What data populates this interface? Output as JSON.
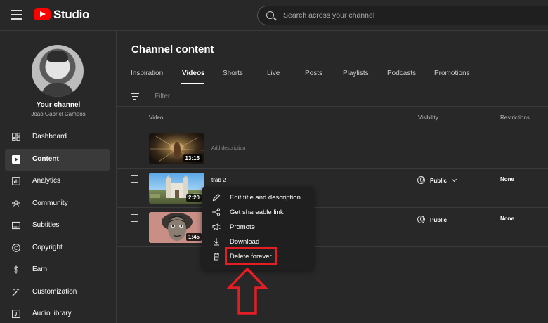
{
  "header": {
    "logo_text": "Studio",
    "search_placeholder": "Search across your channel"
  },
  "sidebar": {
    "channel_title": "Your channel",
    "channel_name": "João Gabriel Campos",
    "items": [
      {
        "label": "Dashboard",
        "icon": "dashboard-icon"
      },
      {
        "label": "Content",
        "icon": "content-icon",
        "active": true
      },
      {
        "label": "Analytics",
        "icon": "analytics-icon"
      },
      {
        "label": "Community",
        "icon": "community-icon"
      },
      {
        "label": "Subtitles",
        "icon": "subtitles-icon"
      },
      {
        "label": "Copyright",
        "icon": "copyright-icon"
      },
      {
        "label": "Earn",
        "icon": "earn-icon"
      },
      {
        "label": "Customization",
        "icon": "customization-icon"
      },
      {
        "label": "Audio library",
        "icon": "audio-library-icon"
      }
    ]
  },
  "main": {
    "title": "Channel content",
    "tabs": [
      "Inspiration",
      "Videos",
      "Shorts",
      "Live",
      "Posts",
      "Playlists",
      "Podcasts",
      "Promotions"
    ],
    "active_tab": "Videos",
    "filter_placeholder": "Filter",
    "columns": {
      "video": "Video",
      "visibility": "Visibility",
      "restrictions": "Restrictions"
    },
    "rows": [
      {
        "title": "",
        "description": "Add description",
        "duration": "13:15",
        "visibility": "",
        "restrictions": ""
      },
      {
        "title": "trab 2",
        "description": "",
        "duration": "2:20",
        "visibility": "Public",
        "restrictions": "None"
      },
      {
        "title": "",
        "description": "",
        "duration": "1:45",
        "visibility": "Public",
        "restrictions": "None"
      }
    ]
  },
  "context_menu": {
    "items": [
      {
        "label": "Edit title and description",
        "icon": "pencil-icon"
      },
      {
        "label": "Get shareable link",
        "icon": "share-icon"
      },
      {
        "label": "Promote",
        "icon": "megaphone-icon"
      },
      {
        "label": "Download",
        "icon": "download-icon"
      },
      {
        "label": "Delete forever",
        "icon": "trash-icon"
      }
    ]
  },
  "annotation": {
    "highlight_color": "#e31e24"
  }
}
